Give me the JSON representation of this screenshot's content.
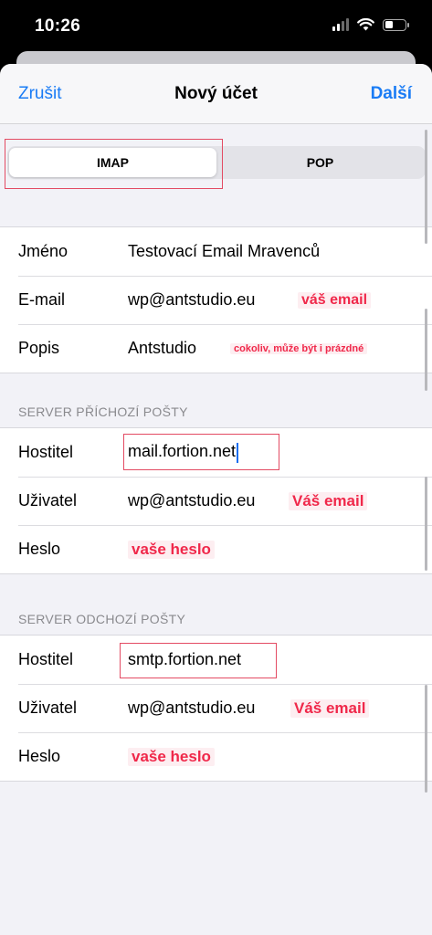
{
  "status_bar": {
    "time": "10:26"
  },
  "nav": {
    "cancel": "Zrušit",
    "title": "Nový účet",
    "next": "Další"
  },
  "segments": {
    "imap": "IMAP",
    "pop": "POP",
    "selected": "IMAP"
  },
  "account": {
    "name_label": "Jméno",
    "name_value": "Testovací Email Mravenců",
    "email_label": "E-mail",
    "email_value": "wp@antstudio.eu",
    "desc_label": "Popis",
    "desc_value": "Antstudio"
  },
  "incoming": {
    "header": "SERVER PŘÍCHOZÍ POŠTY",
    "host_label": "Hostitel",
    "host_value": "mail.fortion.net",
    "user_label": "Uživatel",
    "user_value": "wp@antstudio.eu",
    "pass_label": "Heslo"
  },
  "outgoing": {
    "header": "SERVER ODCHOZÍ POŠTY",
    "host_label": "Hostitel",
    "host_value": "smtp.fortion.net",
    "user_label": "Uživatel",
    "user_value": "wp@antstudio.eu",
    "pass_label": "Heslo"
  },
  "annotations": {
    "email_note": "váš email",
    "desc_note": "cokoliv, může být i prázdné",
    "in_user_note": "Váš email",
    "in_pass_note": "vaše heslo",
    "out_user_note": "Váš email",
    "out_pass_note": "vaše heslo"
  },
  "colors": {
    "accent": "#1a7cf5",
    "annotation": "#f0284a",
    "highlight_border": "#e34b63"
  },
  "icons": [
    "cellular-signal-icon",
    "wifi-icon",
    "battery-icon"
  ]
}
